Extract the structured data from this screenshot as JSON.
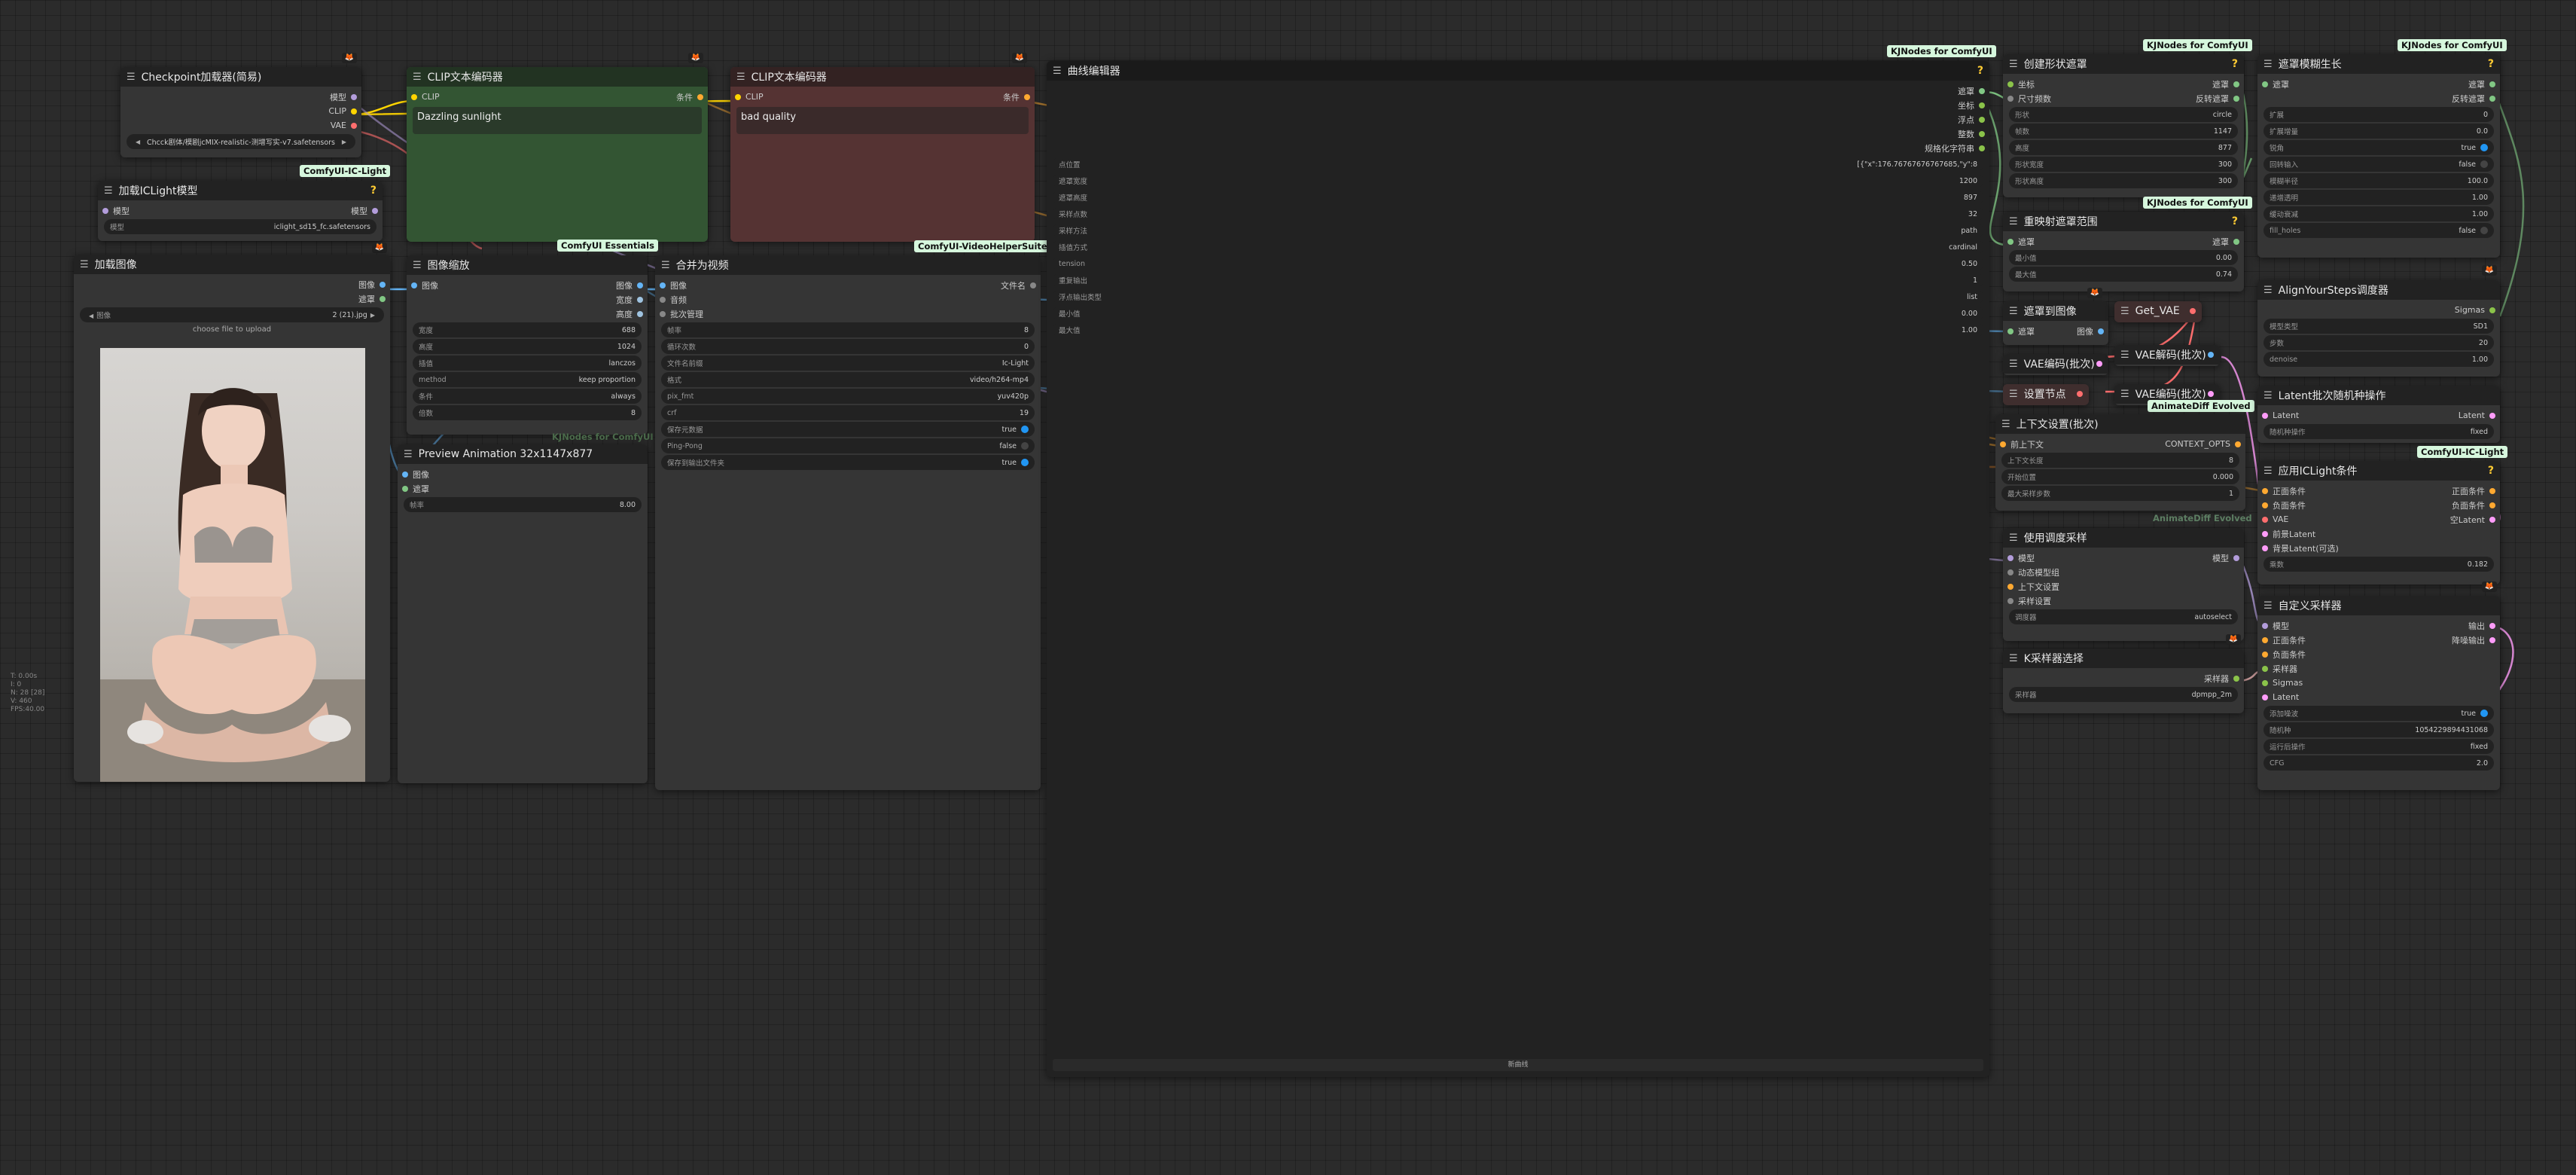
{
  "tags": {
    "ic_light": "ComfyUI-IC-Light",
    "essentials": "ComfyUI Essentials",
    "vhs": "ComfyUI-VideoHelperSuite",
    "kjnodes": "KJNodes for ComfyUI",
    "animatediff": "AnimateDiff Evolved",
    "kjnodes_ghost": "KJNodes for ComfyUI",
    "animatediff_ghost": "AnimateDiff Evolved"
  },
  "ckpt": {
    "title": "Checkpoint加载器(简易)",
    "outputs": [
      "模型",
      "CLIP",
      "VAE"
    ],
    "widget": "Chcck剧体/模剧jcMIX-realistic-测增写实-v7.safetensors"
  },
  "clip_pos": {
    "title": "CLIP文本编码器",
    "in": "CLIP",
    "out": "条件",
    "text": "Dazzling sunlight"
  },
  "clip_neg": {
    "title": "CLIP文本编码器",
    "in": "CLIP",
    "out": "条件",
    "text": "bad quality"
  },
  "iclight_load": {
    "title": "加载ICLight模型",
    "io": "模型",
    "w_label": "模型",
    "w_val": "iclight_sd15_fc.safetensors"
  },
  "load_image": {
    "title": "加载图像",
    "outputs": [
      "图像",
      "遮罩"
    ],
    "w_label": "图像",
    "w_val": "2 (21).jpg",
    "upload": "choose file to upload"
  },
  "resize": {
    "title": "图像缩放",
    "in": "图像",
    "outputs": [
      "图像",
      "宽度",
      "高度"
    ],
    "widgets": [
      {
        "l": "宽度",
        "v": "688"
      },
      {
        "l": "高度",
        "v": "1024"
      },
      {
        "l": "插值",
        "v": "lanczos"
      },
      {
        "l": "method",
        "v": "keep proportion"
      },
      {
        "l": "条件",
        "v": "always"
      },
      {
        "l": "倍数",
        "v": "8"
      }
    ]
  },
  "preview": {
    "title": "Preview Animation 32x1147x877",
    "inputs": [
      "图像",
      "遮罩"
    ],
    "w_label": "帧率",
    "w_val": "8.00"
  },
  "combine": {
    "title": "合并为视频",
    "inputs": [
      "图像",
      "音频",
      "批次管理"
    ],
    "out": "文件名",
    "widgets": [
      {
        "l": "帧率",
        "v": "8"
      },
      {
        "l": "循环次数",
        "v": "0"
      },
      {
        "l": "文件名前缀",
        "v": "Ic-Light"
      },
      {
        "l": "格式",
        "v": "video/h264-mp4"
      },
      {
        "l": "pix_fmt",
        "v": "yuv420p"
      },
      {
        "l": "crf",
        "v": "19"
      },
      {
        "l": "保存元数据",
        "v": "true"
      },
      {
        "l": "Ping-Pong",
        "v": "false"
      },
      {
        "l": "保存到输出文件夹",
        "v": "true"
      }
    ]
  },
  "spline": {
    "title": "曲线编辑器",
    "outputs": [
      "遮罩",
      "坐标",
      "浮点",
      "整数",
      "规格化字符串"
    ],
    "widgets": [
      {
        "l": "点位置",
        "v": "[{\"x\":176.76767676767685,\"y\":8"
      },
      {
        "l": "遮罩宽度",
        "v": "1200"
      },
      {
        "l": "遮罩高度",
        "v": "897"
      },
      {
        "l": "采样点数",
        "v": "32"
      },
      {
        "l": "采样方法",
        "v": "path"
      },
      {
        "l": "插值方式",
        "v": "cardinal"
      },
      {
        "l": "tension",
        "v": "0.50"
      },
      {
        "l": "重复输出",
        "v": "1"
      },
      {
        "l": "浮点输出类型",
        "v": "list"
      },
      {
        "l": "最小值",
        "v": "0.00"
      },
      {
        "l": "最大值",
        "v": "1.00"
      }
    ],
    "footer": "新曲线"
  },
  "shape_mask": {
    "title": "创建形状遮罩",
    "inputs": [
      "坐标",
      "尺寸频数"
    ],
    "outputs": [
      "遮罩",
      "反转遮罩"
    ],
    "widgets": [
      {
        "l": "形状",
        "v": "circle"
      },
      {
        "l": "帧数",
        "v": "1147"
      },
      {
        "l": "高度",
        "v": "877"
      },
      {
        "l": "形状宽度",
        "v": "300"
      },
      {
        "l": "形状高度",
        "v": "300"
      }
    ]
  },
  "grow_mask": {
    "title": "遮罩模糊生长",
    "in": "遮罩",
    "outputs": [
      "遮罩",
      "反转遮罩"
    ],
    "widgets": [
      {
        "l": "扩展",
        "v": "0"
      },
      {
        "l": "扩展增量",
        "v": "0.0"
      },
      {
        "l": "锐角",
        "v": "true"
      },
      {
        "l": "回转输入",
        "v": "false"
      },
      {
        "l": "模糊半径",
        "v": "100.0"
      },
      {
        "l": "递增透明",
        "v": "1.00"
      },
      {
        "l": "缓动衰减",
        "v": "1.00"
      },
      {
        "l": "fill_holes",
        "v": "false"
      }
    ]
  },
  "remap": {
    "title": "重映射遮罩范围",
    "in": "遮罩",
    "out": "遮罩",
    "widgets": [
      {
        "l": "最小值",
        "v": "0.00"
      },
      {
        "l": "最大值",
        "v": "0.74"
      }
    ]
  },
  "mask_to_image": {
    "title": "遮罩到图像",
    "in": "遮罩",
    "out": "图像"
  },
  "get_vae": {
    "title": "Get_VAE"
  },
  "vae_encode": {
    "title": "VAE编码(批次)"
  },
  "vae_decode1": {
    "title": "VAE解码(批次)"
  },
  "vae_decode2": {
    "title": "VAE编码(批次)"
  },
  "set_node": {
    "title": "设置节点"
  },
  "align_steps": {
    "title": "AlignYourSteps调度器",
    "out": "Sigmas",
    "widgets": [
      {
        "l": "模型类型",
        "v": "SD1"
      },
      {
        "l": "步数",
        "v": "20"
      },
      {
        "l": "denoise",
        "v": "1.00"
      }
    ]
  },
  "latent_batch": {
    "title": "Latent批次随机种操作",
    "in": "Latent",
    "out": "Latent",
    "widgets": [
      {
        "l": "随机种操作",
        "v": "fixed"
      }
    ]
  },
  "context": {
    "title": "上下文设置(批次)",
    "in": "前上下文",
    "out": "CONTEXT_OPTS",
    "widgets": [
      {
        "l": "上下文长度",
        "v": "8"
      },
      {
        "l": "开始位置",
        "v": "0.000"
      },
      {
        "l": "最大采样步数",
        "v": "1"
      }
    ]
  },
  "apply_iclight": {
    "title": "应用ICLight条件",
    "inputs": [
      "正面条件",
      "负面条件",
      "VAE",
      "前景Latent",
      "背景Latent(可选)"
    ],
    "outputs": [
      "正面条件",
      "负面条件",
      "空Latent"
    ],
    "w_label": "乘数",
    "w_val": "0.182"
  },
  "evolved": {
    "title": "使用调度采样",
    "inputs": [
      "模型",
      "动态模型组",
      "上下文设置",
      "采样设置"
    ],
    "out": "模型",
    "w_label": "调度器",
    "w_val": "autoselect"
  },
  "ksampler_select": {
    "title": "K采样器选择",
    "out": "采样器",
    "w_label": "采样器",
    "w_val": "dpmpp_2m"
  },
  "custom_sampler": {
    "title": "自定义采样器",
    "inputs": [
      "模型",
      "正面条件",
      "负面条件",
      "采样器",
      "Sigmas",
      "Latent"
    ],
    "outputs": [
      "输出",
      "降噪输出"
    ],
    "widgets": [
      {
        "l": "添加噪波",
        "v": "true"
      },
      {
        "l": "随机种",
        "v": "1054229894431068"
      },
      {
        "l": "运行后操作",
        "v": "fixed"
      },
      {
        "l": "CFG",
        "v": "2.0"
      }
    ]
  },
  "stats": [
    "T: 0.00s",
    "I: 0",
    "N: 28 [28]",
    "V: 460",
    "FPS:40.00"
  ]
}
